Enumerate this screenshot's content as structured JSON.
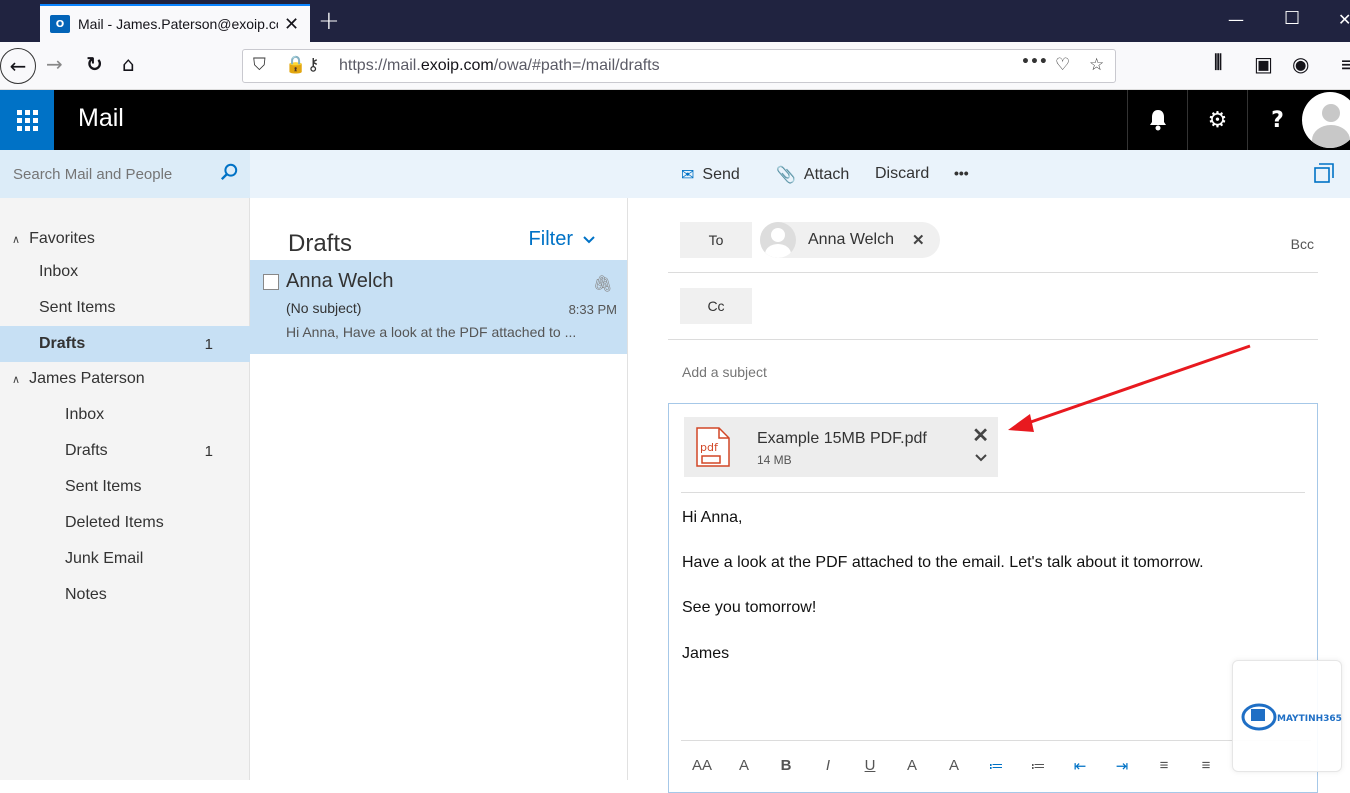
{
  "browser": {
    "tab_title": "Mail - James.Paterson@exoip.co",
    "tab_favicon": "O",
    "new_tab": "+",
    "url_prefix": "https://mail.",
    "url_domain": "exoip.com",
    "url_path": "/owa/#path=/mail/drafts",
    "url_more": "•••"
  },
  "header": {
    "app_title": "Mail",
    "help": "?"
  },
  "commandbar": {
    "search_placeholder": "Search Mail and People",
    "send": "Send",
    "attach": "Attach",
    "discard": "Discard",
    "more": "•••"
  },
  "nav": {
    "favorites_label": "Favorites",
    "favorites": [
      {
        "label": "Inbox",
        "count": ""
      },
      {
        "label": "Sent Items",
        "count": ""
      },
      {
        "label": "Drafts",
        "count": "1"
      }
    ],
    "account_label": "James Paterson",
    "folders": [
      {
        "label": "Inbox",
        "count": ""
      },
      {
        "label": "Drafts",
        "count": "1"
      },
      {
        "label": "Sent Items",
        "count": ""
      },
      {
        "label": "Deleted Items",
        "count": ""
      },
      {
        "label": "Junk Email",
        "count": ""
      },
      {
        "label": "Notes",
        "count": ""
      }
    ]
  },
  "list": {
    "title": "Drafts",
    "filter": "Filter",
    "messages": [
      {
        "from": "Anna Welch",
        "subject": "(No subject)",
        "time": "8:33 PM",
        "preview": "Hi Anna, Have a look at the PDF attached to ..."
      }
    ]
  },
  "compose": {
    "to_label": "To",
    "cc_label": "Cc",
    "bcc_label": "Bcc",
    "recipient": "Anna Welch",
    "subject_placeholder": "Add a subject",
    "attachment": {
      "name": "Example 15MB PDF.pdf",
      "size": "14 MB",
      "type_label": "pdf"
    },
    "body": [
      "Hi Anna,",
      "Have a look at the PDF attached to the email. Let's talk about it tomorrow.",
      "See you tomorrow!",
      "James"
    ],
    "format_tools": [
      "AA",
      "A",
      "B",
      "I",
      "U",
      "A",
      "A",
      "≔",
      "≔",
      "⇤",
      "⇥",
      "≡",
      "≡"
    ]
  },
  "watermark": {
    "brand": "MAYTINH365"
  },
  "colors": {
    "accent": "#0072c6",
    "annotation": "#e8191f",
    "selected": "#c7e0f4"
  }
}
